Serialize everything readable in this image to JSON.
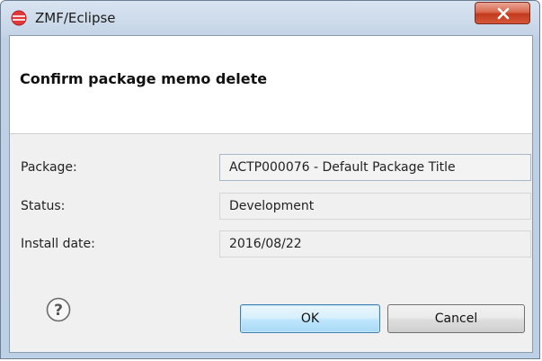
{
  "window": {
    "title": "ZMF/Eclipse",
    "app_icon": "eclipse-icon",
    "close_icon": "close-icon"
  },
  "header": {
    "title": "Confirm package memo delete"
  },
  "fields": [
    {
      "label": "Package:",
      "value": "ACTP000076 - Default Package Title"
    },
    {
      "label": "Status:",
      "value": "Development"
    },
    {
      "label": "Install date:",
      "value": "2016/08/22"
    }
  ],
  "footer": {
    "help_icon": "help-icon",
    "ok_label": "OK",
    "cancel_label": "Cancel"
  },
  "colors": {
    "ok_border": "#3c7fb1",
    "close_red": "#c3391d"
  }
}
